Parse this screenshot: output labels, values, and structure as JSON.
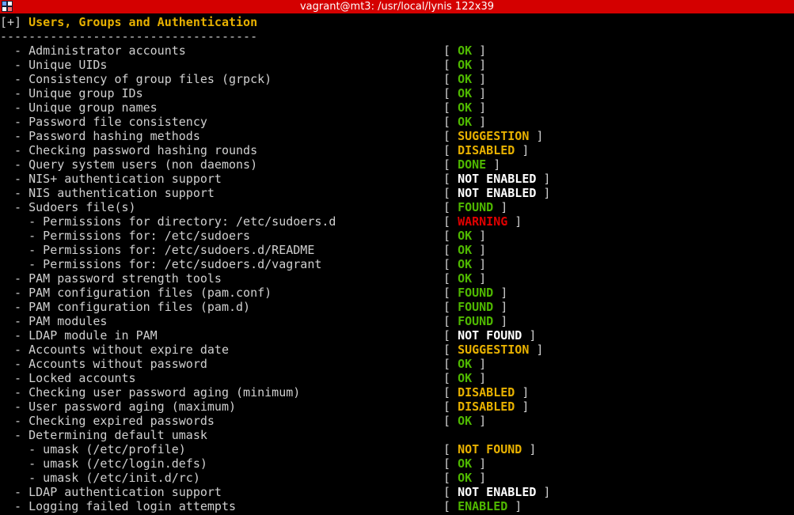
{
  "window": {
    "title": "vagrant@mt3: /usr/local/lynis 122x39"
  },
  "colors": {
    "OK": "#4fb800",
    "DONE": "#4fb800",
    "FOUND": "#4fb800",
    "ENABLED": "#4fb800",
    "SUGGESTION": "#e8b100",
    "DISABLED": "#e8b100",
    "NOT FOUND": "#ffffff",
    "NOT ENABLED": "#ffffff",
    "WARNING": "#e00000"
  },
  "section": {
    "bracket": "[+]",
    "title": "Users, Groups and Authentication",
    "rule": "------------------------------------"
  },
  "checks": [
    {
      "label": "  - Administrator accounts",
      "status": "OK"
    },
    {
      "label": "  - Unique UIDs",
      "status": "OK"
    },
    {
      "label": "  - Consistency of group files (grpck)",
      "status": "OK"
    },
    {
      "label": "  - Unique group IDs",
      "status": "OK"
    },
    {
      "label": "  - Unique group names",
      "status": "OK"
    },
    {
      "label": "  - Password file consistency",
      "status": "OK"
    },
    {
      "label": "  - Password hashing methods",
      "status": "SUGGESTION"
    },
    {
      "label": "  - Checking password hashing rounds",
      "status": "DISABLED"
    },
    {
      "label": "  - Query system users (non daemons)",
      "status": "DONE"
    },
    {
      "label": "  - NIS+ authentication support",
      "status": "NOT ENABLED"
    },
    {
      "label": "  - NIS authentication support",
      "status": "NOT ENABLED"
    },
    {
      "label": "  - Sudoers file(s)",
      "status": "FOUND"
    },
    {
      "label": "    - Permissions for directory: /etc/sudoers.d",
      "status": "WARNING"
    },
    {
      "label": "    - Permissions for: /etc/sudoers",
      "status": "OK"
    },
    {
      "label": "    - Permissions for: /etc/sudoers.d/README",
      "status": "OK"
    },
    {
      "label": "    - Permissions for: /etc/sudoers.d/vagrant",
      "status": "OK"
    },
    {
      "label": "  - PAM password strength tools",
      "status": "OK"
    },
    {
      "label": "  - PAM configuration files (pam.conf)",
      "status": "FOUND"
    },
    {
      "label": "  - PAM configuration files (pam.d)",
      "status": "FOUND"
    },
    {
      "label": "  - PAM modules",
      "status": "FOUND"
    },
    {
      "label": "  - LDAP module in PAM",
      "status": "NOT FOUND"
    },
    {
      "label": "  - Accounts without expire date",
      "status": "SUGGESTION"
    },
    {
      "label": "  - Accounts without password",
      "status": "OK"
    },
    {
      "label": "  - Locked accounts",
      "status": "OK"
    },
    {
      "label": "  - Checking user password aging (minimum)",
      "status": "DISABLED"
    },
    {
      "label": "  - User password aging (maximum)",
      "status": "DISABLED"
    },
    {
      "label": "  - Checking expired passwords",
      "status": "OK"
    },
    {
      "label": "  - Determining default umask",
      "status": null
    },
    {
      "label": "    - umask (/etc/profile)",
      "status": "NOT FOUND"
    },
    {
      "label": "    - umask (/etc/login.defs)",
      "status": "OK"
    },
    {
      "label": "    - umask (/etc/init.d/rc)",
      "status": "OK"
    },
    {
      "label": "  - LDAP authentication support",
      "status": "NOT ENABLED"
    },
    {
      "label": "  - Logging failed login attempts",
      "status": "ENABLED"
    }
  ],
  "status_colors_by_row": {
    "20": "#ffffff",
    "28": "#e8b100"
  }
}
